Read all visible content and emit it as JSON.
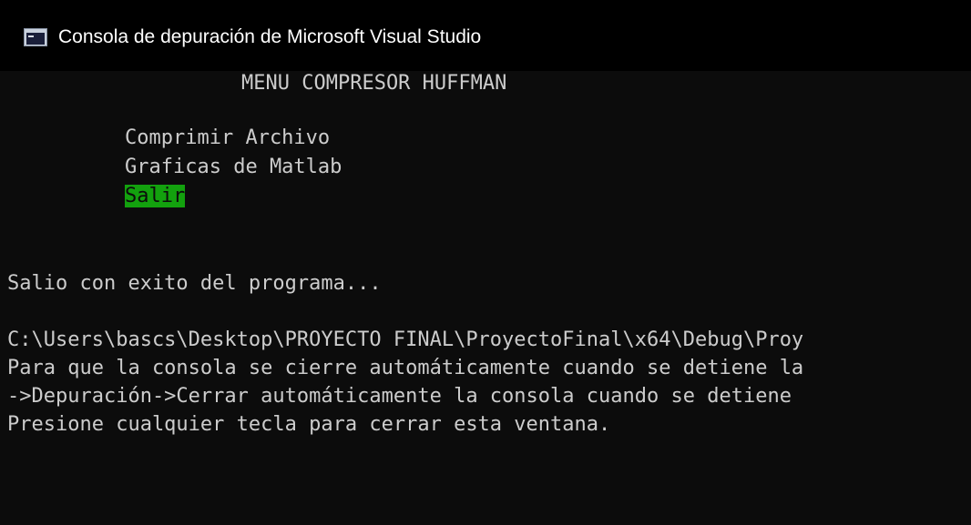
{
  "window": {
    "title": "Consola de depuración de Microsoft Visual Studio",
    "icon": "console-app-icon"
  },
  "menu": {
    "heading": "MENU COMPRESOR HUFFMAN",
    "options": [
      "Comprimir Archivo",
      "Graficas de Matlab",
      "Salir"
    ],
    "selected_index": 2,
    "selected_color": "#13a10e"
  },
  "output": {
    "exit_message": "Salio con exito del programa...",
    "lines": [
      "C:\\Users\\bascs\\Desktop\\PROYECTO FINAL\\ProyectoFinal\\x64\\Debug\\Proy",
      "Para que la consola se cierre automáticamente cuando se detiene la",
      "->Depuración->Cerrar automáticamente la consola cuando se detiene",
      "Presione cualquier tecla para cerrar esta ventana."
    ]
  },
  "colors": {
    "console_background": "#0c0c0c",
    "console_text": "#cccccc",
    "titlebar_background": "#000000",
    "titlebar_text": "#ffffff"
  }
}
